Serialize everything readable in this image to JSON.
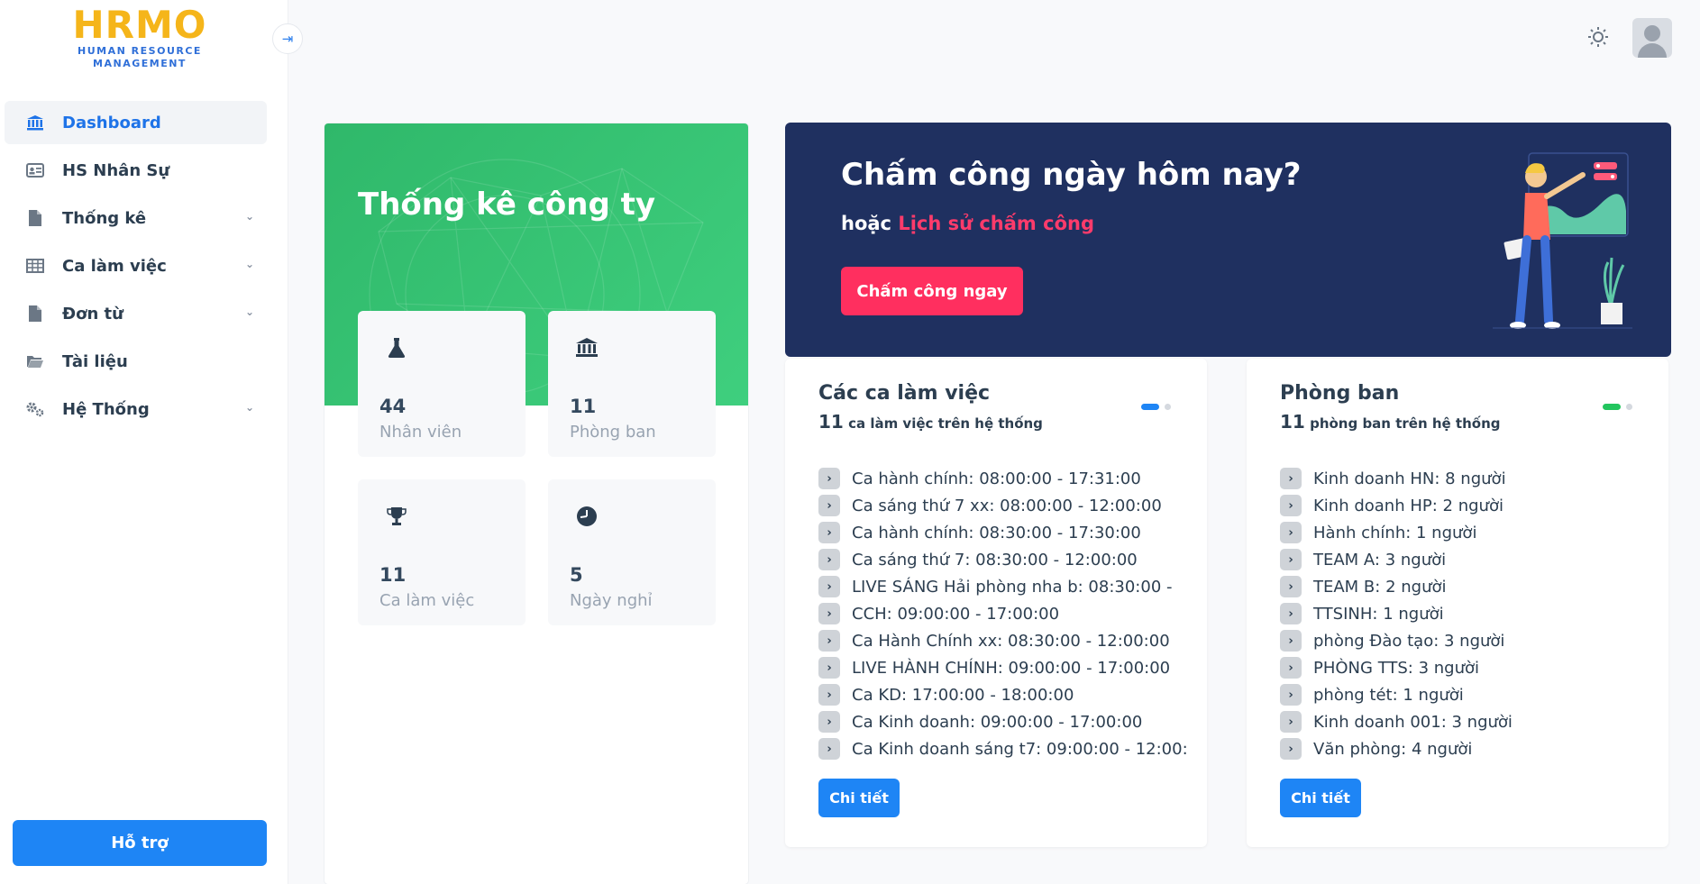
{
  "logo": {
    "main": "HRMO",
    "line1": "HUMAN RESOURCE",
    "line2": "MANAGEMENT"
  },
  "sidebar": {
    "items": [
      {
        "label": "Dashboard",
        "icon": "bank-icon",
        "active": true
      },
      {
        "label": "HS Nhân Sự",
        "icon": "id-card-icon"
      },
      {
        "label": "Thống kê",
        "icon": "file-icon",
        "expandable": true
      },
      {
        "label": "Ca làm việc",
        "icon": "table-icon",
        "expandable": true
      },
      {
        "label": "Đơn từ",
        "icon": "file-icon",
        "expandable": true
      },
      {
        "label": "Tài liệu",
        "icon": "folder-icon"
      },
      {
        "label": "Hệ Thống",
        "icon": "cogs-icon",
        "expandable": true
      }
    ],
    "support_label": "Hỗ trợ"
  },
  "stats": {
    "title": "Thống kê công ty",
    "tiles": [
      {
        "value": "44",
        "label": "Nhân viên",
        "icon": "flask-icon"
      },
      {
        "value": "11",
        "label": "Phòng ban",
        "icon": "bank-icon"
      },
      {
        "value": "11",
        "label": "Ca làm việc",
        "icon": "trophy-icon"
      },
      {
        "value": "5",
        "label": "Ngày nghỉ",
        "icon": "clock-icon"
      }
    ]
  },
  "banner": {
    "title": "Chấm công ngày hôm nay?",
    "sub_prefix": "hoặc",
    "sub_link": "Lịch sử chấm công",
    "button_label": "Chấm công ngay"
  },
  "shifts": {
    "title": "Các ca làm việc",
    "count": "11",
    "count_suffix": "ca làm việc trên hệ thống",
    "items": [
      "Ca hành chính: 08:00:00 - 17:31:00",
      "Ca sáng thứ 7 xx: 08:00:00 - 12:00:00",
      "Ca hành chính: 08:30:00 - 17:30:00",
      "Ca sáng thứ 7: 08:30:00 - 12:00:00",
      "LIVE SÁNG Hải phòng nha b: 08:30:00 -",
      "CCH: 09:00:00 - 17:00:00",
      "Ca Hành Chính xx: 08:30:00 - 12:00:00",
      "LIVE HÀNH CHÍNH: 09:00:00 - 17:00:00",
      "Ca KD: 17:00:00 - 18:00:00",
      "Ca Kinh doanh: 09:00:00 - 17:00:00",
      "Ca Kinh doanh sáng t7: 09:00:00 - 12:00:"
    ],
    "detail_label": "Chi tiết",
    "dot_color": "#1e85f5"
  },
  "departments": {
    "title": "Phòng ban",
    "count": "11",
    "count_suffix": "phòng ban trên hệ thống",
    "items": [
      "Kinh doanh HN: 8 người",
      "Kinh doanh HP: 2 người",
      "Hành chính: 1 người",
      "TEAM A: 3 người",
      "TEAM B: 2 người",
      "TTSINH: 1 người",
      "phòng Đào tạo: 3 người",
      "PHÒNG TTS: 3 người",
      "phòng tét: 1 người",
      "Kinh doanh 001: 3 người",
      "Văn phòng: 4 người"
    ],
    "detail_label": "Chi tiết",
    "dot_color": "#22c55e"
  },
  "colors": {
    "primary": "#1e85f5",
    "banner_bg": "#1f3060",
    "accent": "#ff2f5f",
    "stats_green": "#3fcf7e",
    "logo_yellow": "#f5b51a"
  }
}
